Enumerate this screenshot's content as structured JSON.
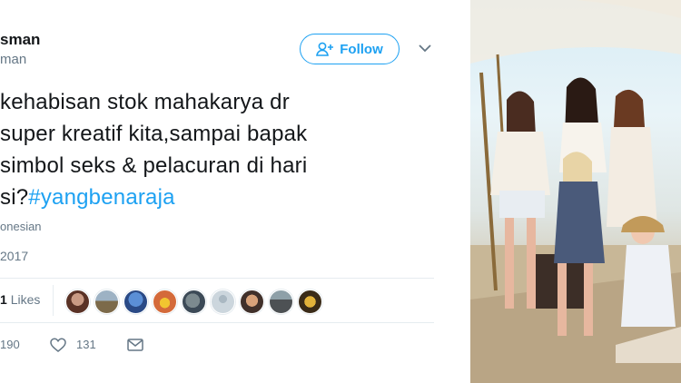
{
  "tweet": {
    "display_name": "sman",
    "handle": "man",
    "follow_label": "Follow",
    "lines": [
      "kehabisan stok mahakarya dr",
      "super kreatif kita,sampai bapak",
      "simbol seks & pelacuran di hari",
      "si?"
    ],
    "hashtag": "#yangbenaraja",
    "language": "onesian",
    "date": "2017",
    "likes_count": "1",
    "likes_label": "Likes",
    "retweet_count": "190",
    "like_count": "131"
  },
  "colors": {
    "accent": "#1da1f2",
    "text": "#14171a",
    "muted": "#657786",
    "border": "#e6ecf0"
  },
  "icons": [
    "follow-person-icon",
    "chevron-down-icon",
    "heart-icon",
    "envelope-icon"
  ]
}
